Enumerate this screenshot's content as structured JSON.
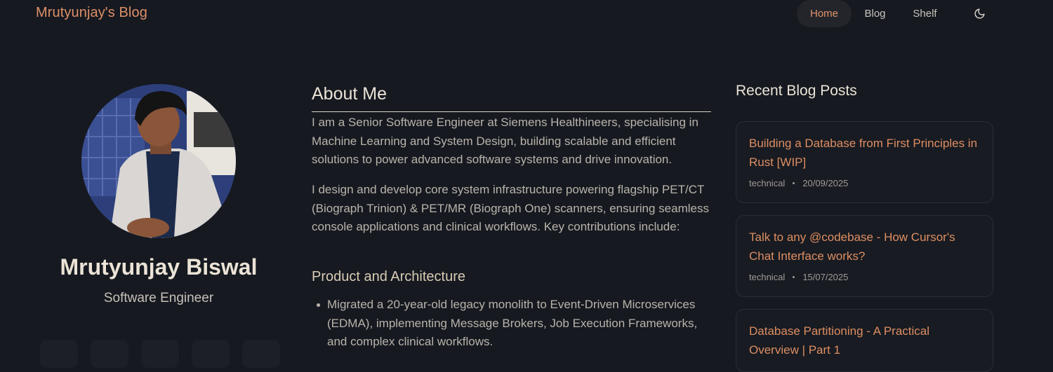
{
  "header": {
    "brand": "Mrutyunjay's Blog",
    "nav": [
      {
        "label": "Home",
        "active": true
      },
      {
        "label": "Blog",
        "active": false
      },
      {
        "label": "Shelf",
        "active": false
      }
    ],
    "theme_toggle_icon": "moon-icon"
  },
  "profile": {
    "name": "Mrutyunjay Biswal",
    "role": "Software Engineer",
    "avatar_icon": "profile-photo"
  },
  "about": {
    "title": "About Me",
    "paragraphs": [
      "I am a Senior Software Engineer at Siemens Healthineers, specialising in Machine Learning and System Design, building scalable and efficient solutions to power advanced software systems and drive innovation.",
      "I design and develop core system infrastructure powering flagship PET/CT (Biograph Trinion) & PET/MR (Biograph One) scanners, ensuring seamless console applications and clinical workflows. Key contributions include:"
    ],
    "subheading": "Product and Architecture",
    "bullets": [
      "Migrated a 20-year-old legacy monolith to Event-Driven Microservices (EDMA), implementing Message Brokers, Job Execution Frameworks, and complex clinical workflows."
    ]
  },
  "recent_posts": {
    "title": "Recent Blog Posts",
    "posts": [
      {
        "title": "Building a Database from First Principles in Rust [WIP]",
        "category": "technical",
        "date": "20/09/2025"
      },
      {
        "title": "Talk to any @codebase - How Cursor's Chat Interface works?",
        "category": "technical",
        "date": "15/07/2025"
      },
      {
        "title": "Database Partitioning - A Practical Overview | Part 1",
        "category": "",
        "date": ""
      }
    ]
  },
  "colors": {
    "background": "#161920",
    "accent": "#de8e62",
    "heading": "#ebe3d6",
    "body_text": "#b9b4ab"
  }
}
